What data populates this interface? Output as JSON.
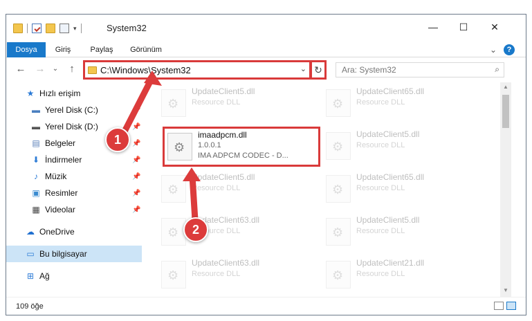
{
  "window": {
    "title": "System32",
    "controls": {
      "minimize": "—",
      "maximize": "☐",
      "close": "✕"
    }
  },
  "ribbon": {
    "tabs": [
      "Dosya",
      "Giriş",
      "Paylaş",
      "Görünüm"
    ],
    "active_tab": "Dosya",
    "expand": "⌄",
    "help": "?"
  },
  "navigation": {
    "back": "←",
    "forward": "→",
    "recent": "⌄",
    "up": "↑",
    "address_path": "C:\\Windows\\System32",
    "address_dropdown": "⌄",
    "refresh": "↻",
    "search_placeholder": "Ara: System32",
    "search_icon": "⌕"
  },
  "sidebar": {
    "items": [
      {
        "label": "Hızlı erişim",
        "icon": "star-icon",
        "glyph": "★",
        "color": "#2b7bd6",
        "pinned": false
      },
      {
        "label": "Yerel Disk (C:)",
        "icon": "windows-drive-icon",
        "glyph": "▬",
        "color": "#4a7fbf",
        "pinned": true
      },
      {
        "label": "Yerel Disk (D:)",
        "icon": "drive-icon",
        "glyph": "▬",
        "color": "#555555",
        "pinned": true
      },
      {
        "label": "Belgeler",
        "icon": "documents-icon",
        "glyph": "▤",
        "color": "#5a7fb8",
        "pinned": true
      },
      {
        "label": "İndirmeler",
        "icon": "downloads-icon",
        "glyph": "⬇",
        "color": "#2b7bd6",
        "pinned": true
      },
      {
        "label": "Müzik",
        "icon": "music-icon",
        "glyph": "♪",
        "color": "#2b7bd6",
        "pinned": true
      },
      {
        "label": "Resimler",
        "icon": "pictures-icon",
        "glyph": "▣",
        "color": "#3a8bd0",
        "pinned": true
      },
      {
        "label": "Videolar",
        "icon": "videos-icon",
        "glyph": "▦",
        "color": "#444444",
        "pinned": true
      },
      {
        "label": "OneDrive",
        "icon": "onedrive-icon",
        "glyph": "☁",
        "color": "#1f6fd0",
        "pinned": false
      },
      {
        "label": "Bu bilgisayar",
        "icon": "computer-icon",
        "glyph": "▭",
        "color": "#2b7bd6",
        "pinned": false,
        "selected": true
      },
      {
        "label": "Ağ",
        "icon": "network-icon",
        "glyph": "⊞",
        "color": "#2b7bd6",
        "pinned": false
      }
    ],
    "pin_glyph": "📌"
  },
  "files": [
    {
      "name": "UpdateClient5.dll",
      "desc": "Resource DLL"
    },
    {
      "name": "UpdateClient65.dll",
      "desc": "Resource DLL"
    },
    {
      "name": "UpdateClient5.dll",
      "desc": "Resource DLL"
    },
    {
      "name": "UpdateClient5.dll",
      "desc": "Resource DLL"
    },
    {
      "name": "UpdateClient65.dll",
      "desc": "Resource DLL"
    },
    {
      "name": "UpdateClient63.dll",
      "desc": "Resource DLL"
    },
    {
      "name": "UpdateClient5.dll",
      "desc": "Resource DLL"
    },
    {
      "name": "UpdateClient63.dll",
      "desc": "Resource DLL"
    },
    {
      "name": "UpdateClient21.dll",
      "desc": "Resource DLL"
    }
  ],
  "highlighted_file": {
    "name": "imaadpcm.dll",
    "version": "1.0.0.1",
    "description": "IMA ADPCM CODEC - D..."
  },
  "status": {
    "item_count": "109 öğe"
  },
  "callouts": {
    "first": "1",
    "second": "2",
    "color": "#dc3b3b"
  }
}
